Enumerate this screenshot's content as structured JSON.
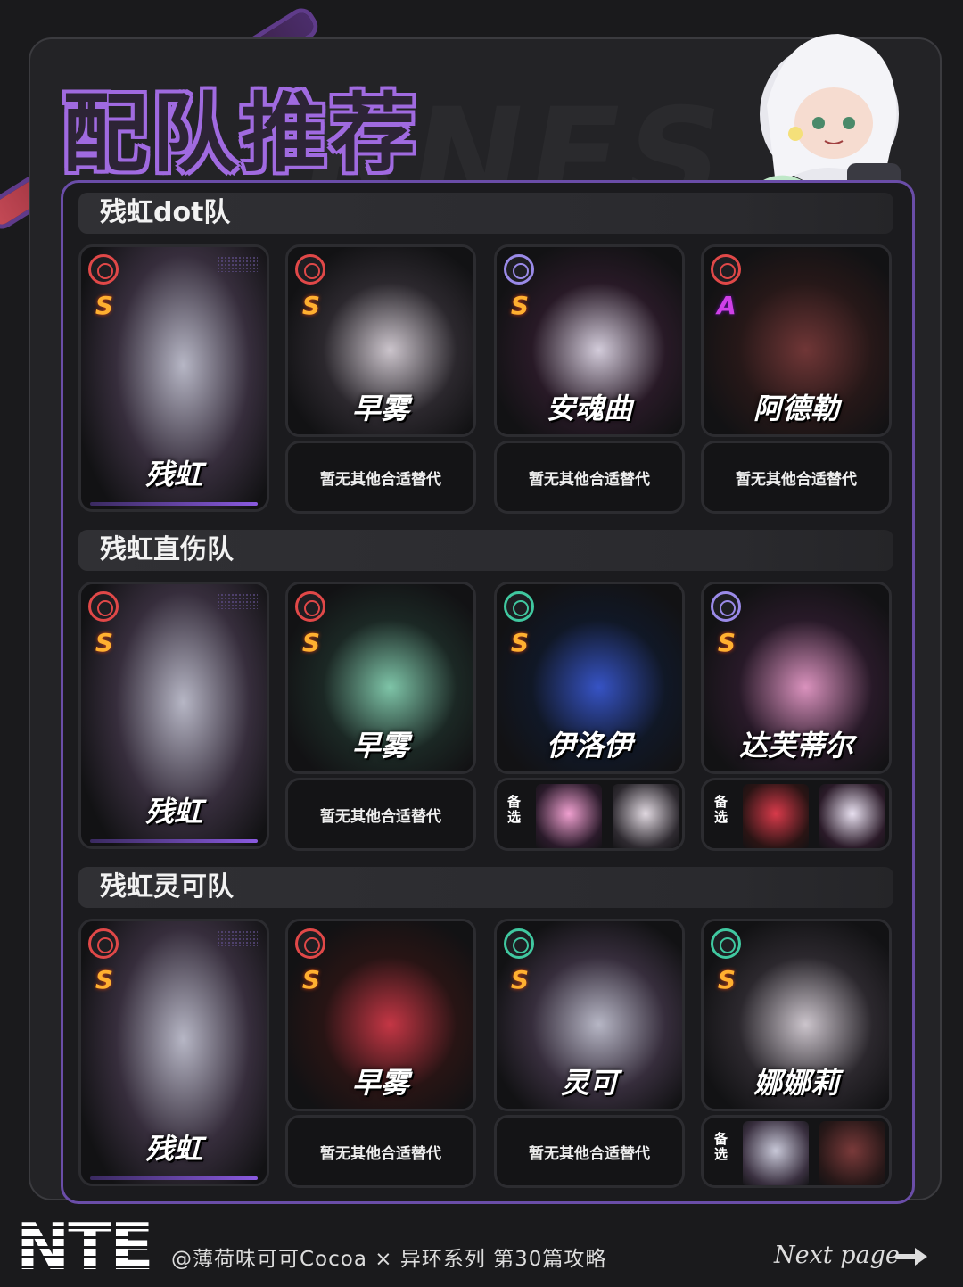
{
  "page": {
    "title": "配队推荐",
    "background_word": "RNES"
  },
  "colors": {
    "accent_purple": "#a06ae0",
    "panel_border": "#6a4da8",
    "element_red": "#e04848",
    "element_purple": "#9a8ae8",
    "element_green": "#40c8a0",
    "rank_s": "#ffb030",
    "rank_a": "#d040e8"
  },
  "teams": [
    {
      "name": "残虹dot队",
      "main": {
        "name": "残虹",
        "element": "red-target-icon",
        "rank": "S"
      },
      "members": [
        {
          "name": "早雾",
          "element": "red-target-icon",
          "rank": "S",
          "alt_text": "暂无其他合适替代"
        },
        {
          "name": "安魂曲",
          "element": "purple-star-icon",
          "rank": "S",
          "alt_text": "暂无其他合适替代"
        },
        {
          "name": "阿德勒",
          "element": "red-target-icon",
          "rank": "A",
          "alt_text": "暂无其他合适替代"
        }
      ]
    },
    {
      "name": "残虹直伤队",
      "main": {
        "name": "残虹",
        "element": "red-target-icon",
        "rank": "S"
      },
      "members": [
        {
          "name": "早雾",
          "element": "red-target-icon",
          "rank": "S",
          "alt_text": "暂无其他合适替代"
        },
        {
          "name": "伊洛伊",
          "element": "green-flame-icon",
          "rank": "S",
          "alt_label": "备选"
        },
        {
          "name": "达芙蒂尔",
          "element": "purple-star-icon",
          "rank": "S",
          "alt_label": "备选"
        }
      ]
    },
    {
      "name": "残虹灵可队",
      "main": {
        "name": "残虹",
        "element": "red-target-icon",
        "rank": "S"
      },
      "members": [
        {
          "name": "早雾",
          "element": "red-target-icon",
          "rank": "S",
          "alt_text": "暂无其他合适替代"
        },
        {
          "name": "灵可",
          "element": "green-flame-icon",
          "rank": "S",
          "alt_text": "暂无其他合适替代"
        },
        {
          "name": "娜娜莉",
          "element": "green-flame-icon",
          "rank": "S",
          "alt_label": "备选"
        }
      ]
    }
  ],
  "footer": {
    "logo": "NTE",
    "credit": "@薄荷味可可Cocoa × 异环系列 第30篇攻略",
    "next": "Next page"
  }
}
